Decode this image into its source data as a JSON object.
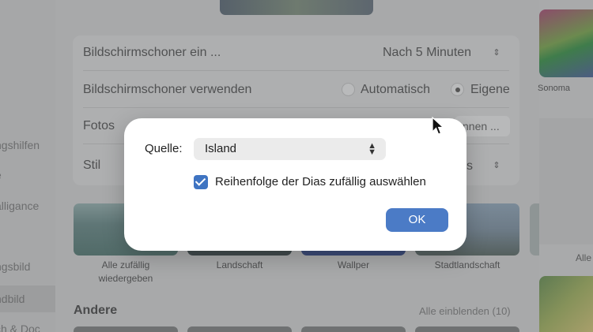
{
  "sidebar": {
    "items": [
      {
        "label": "ngshilfen"
      },
      {
        "label": "e"
      },
      {
        "label": "alligance"
      },
      {
        "label": "ngsbild"
      },
      {
        "label": "ndbild"
      },
      {
        "label": "ch & Doc"
      }
    ]
  },
  "settings": {
    "screensaver_start_label": "Bildschirmschoner ein ...",
    "screensaver_start_value": "Nach 5 Minuten",
    "screensaver_use_label": "Bildschirmschoner verwenden",
    "option_auto": "Automatisch",
    "option_custom": "Eigene",
    "photos_label": "Fotos",
    "photos_button": "nnen ...",
    "style_label": "Stil",
    "style_value_partial": "s"
  },
  "tiles": [
    {
      "label": "Alle zufällig\nwiedergeben"
    },
    {
      "label": "Landschaft"
    },
    {
      "label": "Wallper"
    },
    {
      "label": "Stadtlandschaft"
    }
  ],
  "other_section": {
    "title": "Andere",
    "show_all": "Alle einblenden (10)"
  },
  "right_panel": {
    "wallpaper_label": "Sonoma",
    "all_label": "Alle"
  },
  "dialog": {
    "source_label": "Quelle:",
    "source_value": "Island",
    "shuffle_label": "Reihenfolge der Dias zufällig auswählen",
    "shuffle_checked": true,
    "ok_label": "OK",
    "accent_color": "#4b7bc6"
  }
}
